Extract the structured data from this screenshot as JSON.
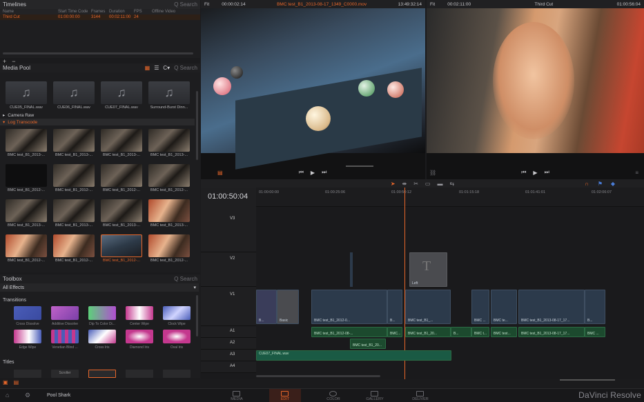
{
  "timelines": {
    "title": "Timelines",
    "search": "Q Search",
    "columns": [
      "Name",
      "Start Time Code",
      "Frames",
      "Duration",
      "FPS",
      "Offline Video"
    ],
    "row": {
      "name": "Third Cut",
      "start": "01:00:00:00",
      "frames": "3144",
      "duration": "00:02:11:00",
      "fps": "24"
    }
  },
  "mediapool": {
    "title": "Media Pool",
    "search": "Q Search",
    "audio_clips": [
      "CUE05_FINAL.wav",
      "CUE06_FINAL.wav",
      "CUE07_FINAL.wav",
      "Surround-Burst Dinn..."
    ],
    "bins": [
      "Camera Raw",
      "Log Transcode"
    ],
    "clips_row1": [
      "BMC test_B1_2013-...",
      "BMC test_B1_2013-...",
      "BMC test_B1_2013-...",
      "BMC test_B1_2013-..."
    ],
    "clips_row2": [
      "BMC test_B1_2012-...",
      "BMC test_B1_2012-...",
      "BMC test_B1_2012-...",
      "BMC test_B1_2012-..."
    ],
    "clips_row3": [
      "BMC test_B1_2013-...",
      "BMC test_B1_2013-...",
      "BMC test_B1_2013-...",
      "BMC test_B1_2013-..."
    ],
    "clips_row4": [
      "BMC test_B1_2012-...",
      "BMC test_B1_2012-...",
      "BMC test_B1_2012-...",
      "BMC test_B1_2012-..."
    ]
  },
  "toolbox": {
    "title": "Toolbox",
    "search": "Q Search",
    "all_effects": "All Effects",
    "transitions": "Transitions",
    "transitions_row1": [
      "Cross Dissolve",
      "Additive Dissolve",
      "Dip To Color Di...",
      "Center Wipe",
      "Clock Wipe"
    ],
    "transitions_row2": [
      "Edge Wipe",
      "Venetian Blind ...",
      "Cross Iris",
      "Diamond Iris",
      "Oval Iris"
    ],
    "titles": "Titles",
    "title_items": [
      "Scroller"
    ]
  },
  "source_viewer": {
    "zoom": "Fit",
    "timecode": "00:00:02:14",
    "clip": "BMC test_B1_2013-08-17_1349_C0000.mov",
    "clip_tc": "13:49:32:14"
  },
  "record_viewer": {
    "zoom": "Fit",
    "timecode": "00:02:11:00",
    "timeline": "Third Cut",
    "tc": "01:00:56:04"
  },
  "timeline": {
    "playhead_tc": "01:00:50:04",
    "ruler": [
      "01:00:00:00",
      "01:00:25:06",
      "01:00:50:12",
      "01:01:15:18",
      "01:01:41:01",
      "01:02:06:07"
    ],
    "tracks": [
      {
        "name": "V3"
      },
      {
        "name": "V2"
      },
      {
        "name": "V1"
      },
      {
        "name": "A1"
      },
      {
        "name": "A2"
      },
      {
        "name": "A3"
      },
      {
        "name": "A4"
      }
    ],
    "title_clip_label": "Left",
    "v1_labels": [
      "B...",
      "Basic",
      "BMC test_B1_2012-0...",
      "B...",
      "BMC test_B1_...",
      "BMC ...",
      "BMC te...",
      "BMC test_B1_2013-08-17_17...",
      "B..."
    ],
    "a1_labels": [
      "BMC test_B1_2012-08-...",
      "BMC...",
      "BMC test_B1_20...",
      "B...",
      "BMC t...",
      "BMC test...",
      "BMC test_B1_2013-08-17_17...",
      "BMC ..."
    ],
    "a2_label": "BMC test_B1_20...",
    "a3_label": "CUE07_FINAL.wav"
  },
  "bottom": {
    "project": "Pool Shark",
    "pages": [
      "MEDIA",
      "EDIT",
      "COLOR",
      "GALLERY",
      "DELIVER"
    ],
    "active_page": "EDIT",
    "brand": "DaVinci Resolve"
  }
}
